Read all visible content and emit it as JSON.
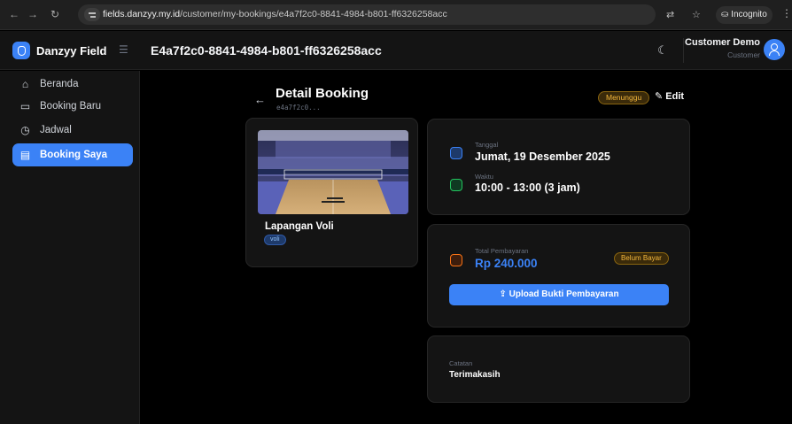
{
  "browser": {
    "url_host": "fields.danzyy.my.id",
    "url_path": "/customer/my-bookings/e4a7f2c0-8841-4984-b801-ff6326258acc",
    "incognito_label": "Incognito"
  },
  "header": {
    "brand": "Danzyy Field",
    "title": "E4a7f2c0-8841-4984-b801-ff6326258acc",
    "user_name": "Customer Demo",
    "user_role": "Customer"
  },
  "sidebar": {
    "items": [
      {
        "label": "Beranda",
        "icon": "home-icon",
        "active": false
      },
      {
        "label": "Booking Baru",
        "icon": "calendar-icon",
        "active": false
      },
      {
        "label": "Jadwal",
        "icon": "clock-icon",
        "active": false
      },
      {
        "label": "Booking Saya",
        "icon": "document-icon",
        "active": true
      }
    ]
  },
  "page": {
    "title": "Detail Booking",
    "subtitle": "e4a7f2c0...",
    "status": "Menunggu",
    "edit_label": "Edit"
  },
  "venue": {
    "name": "Lapangan Voli",
    "tag": "voli"
  },
  "schedule": {
    "date_label": "Tanggal",
    "date_value": "Jumat, 19 Desember 2025",
    "time_label": "Waktu",
    "time_value": "10:00 - 13:00 (3 jam)"
  },
  "payment": {
    "label": "Total Pembayaran",
    "amount": "Rp 240.000",
    "status": "Belum Bayar",
    "upload_label": "Upload Bukti Pembayaran"
  },
  "note": {
    "label": "Catatan",
    "value": "Terimakasih"
  },
  "colors": {
    "accent": "#3b82f6",
    "warning": "#f5b83d",
    "success": "#22c55e",
    "danger": "#f97316"
  }
}
